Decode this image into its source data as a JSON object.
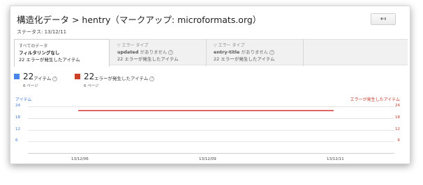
{
  "header": {
    "title": "構造化データ > hentry（マークアップ: microformats.org）",
    "back_label": "↤",
    "status": "ステータス: 13/12/11"
  },
  "tabs": [
    {
      "line1": "すべてのデータ",
      "line2": "フィルタリングなし",
      "line3": "22 エラーが発生したアイテム"
    },
    {
      "line1": "エラー タイプ",
      "line2_strong": "updated",
      "line2_rest": " がありません",
      "line3": "22 エラーが発生したアイテム"
    },
    {
      "line1": "エラー タイプ",
      "line2_strong": "entry-title",
      "line2_rest": " がありません",
      "line3": "22 エラーが発生したアイテム"
    }
  ],
  "legend": {
    "items": {
      "count": "22",
      "label": "アイテム",
      "pages": "6 ページ",
      "color": "#4a86e8"
    },
    "errors": {
      "count": "22",
      "label": "エラーが発生したアイテム",
      "pages": "6 ページ",
      "color": "#cc4125"
    }
  },
  "chart_data": {
    "type": "line",
    "left_axis_title": "アイテム",
    "right_axis_title": "エラーが発生したアイテム",
    "y_ticks": [
      "24",
      "18",
      "12",
      "6"
    ],
    "x_ticks": [
      "13/12/06",
      "13/12/09",
      "13/12/11"
    ],
    "ylim": [
      0,
      24
    ],
    "series": [
      {
        "name": "エラーが発生したアイテム",
        "x": [
          "13/12/06",
          "13/12/11"
        ],
        "values": [
          22,
          22
        ],
        "color": "#e06666"
      }
    ]
  }
}
